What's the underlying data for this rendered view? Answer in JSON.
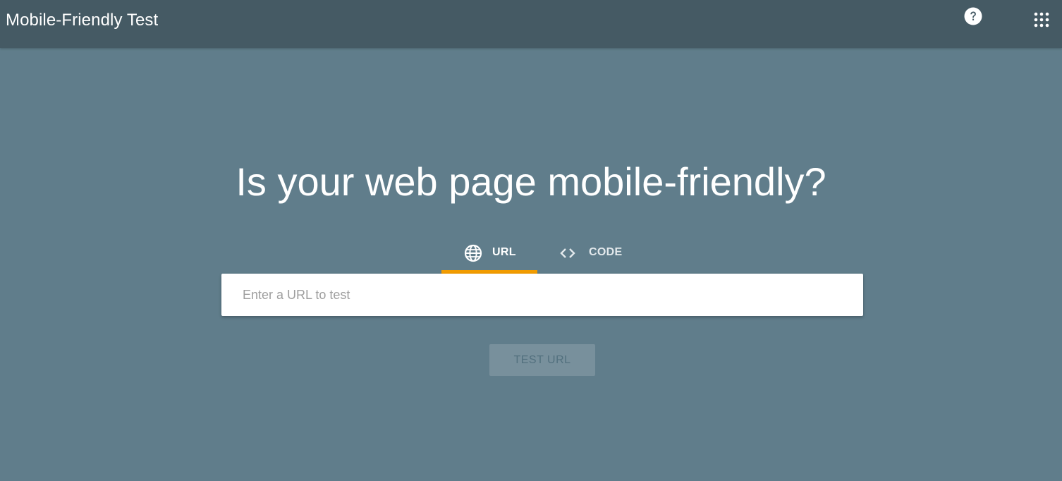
{
  "header": {
    "title": "Mobile-Friendly Test",
    "help_icon": "help-circle-icon",
    "apps_icon": "apps-grid-icon"
  },
  "main": {
    "headline": "Is your web page mobile-friendly?",
    "tabs": [
      {
        "label": "URL",
        "icon": "globe-icon",
        "selected": true
      },
      {
        "label": "CODE",
        "icon": "code-brackets-icon",
        "selected": false
      }
    ],
    "url_input": {
      "placeholder": "Enter a URL to test",
      "value": ""
    },
    "test_button": {
      "label": "TEST URL",
      "disabled": true
    }
  },
  "colors": {
    "background": "#607d8b",
    "appbar": "#455a64",
    "tab_indicator": "#f29c00",
    "button_disabled_bg": "#78909c",
    "button_disabled_text": "#52707e"
  }
}
